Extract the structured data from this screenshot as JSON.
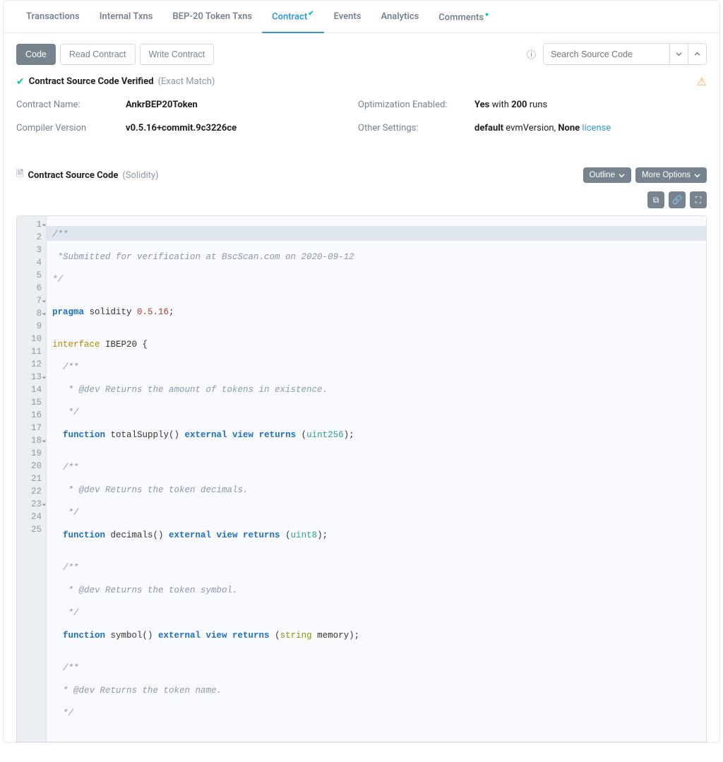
{
  "tabs": {
    "transactions": "Transactions",
    "internal": "Internal Txns",
    "bep20": "BEP-20 Token Txns",
    "contract": "Contract",
    "events": "Events",
    "analytics": "Analytics",
    "comments": "Comments"
  },
  "toolbar": {
    "code": "Code",
    "read": "Read Contract",
    "write": "Write Contract"
  },
  "search": {
    "placeholder": "Search Source Code"
  },
  "verified": {
    "title": "Contract Source Code Verified",
    "match": "(Exact Match)"
  },
  "info": {
    "name_lbl": "Contract Name:",
    "name_val": "AnkrBEP20Token",
    "compiler_lbl": "Compiler Version",
    "compiler_val": "v0.5.16+commit.9c3226ce",
    "opt_lbl": "Optimization Enabled:",
    "opt_yes": "Yes",
    "opt_with": " with ",
    "opt_runs": "200",
    "opt_runs_suf": " runs",
    "other_lbl": "Other Settings:",
    "other_default": "default",
    "other_evm": " evmVersion, ",
    "other_none": "None",
    "other_license": "license"
  },
  "source": {
    "heading": "Contract Source Code",
    "lang": "(Solidity)",
    "outline": "Outline",
    "more": "More Options"
  },
  "code": {
    "l1": "/**",
    "l2": " *Submitted for verification at BscScan.com on 2020-09-12",
    "l3": "*/",
    "l4": "",
    "l5a": "pragma",
    "l5b": " solidity ",
    "l5c": "0.5.16",
    "l5d": ";",
    "l6": "",
    "l7a": "interface",
    "l7b": " IBEP20 {",
    "l8": "  /**",
    "l9": "   * @dev Returns the amount of tokens in existence.",
    "l10": "   */",
    "l11a": "  function",
    "l11b": " totalSupply() ",
    "l11c": "external view returns",
    "l11d": " (",
    "l11e": "uint256",
    "l11f": ");",
    "l12": "",
    "l13": "  /**",
    "l14": "   * @dev Returns the token decimals.",
    "l15": "   */",
    "l16a": "  function",
    "l16b": " decimals() ",
    "l16c": "external view returns",
    "l16d": " (",
    "l16e": "uint8",
    "l16f": ");",
    "l17": "",
    "l18": "  /**",
    "l19": "   * @dev Returns the token symbol.",
    "l20": "   */",
    "l21a": "  function",
    "l21b": " symbol() ",
    "l21c": "external view returns",
    "l21d": " (",
    "l21e": "string",
    "l21f": " memory);",
    "l22": "",
    "l23": "  /**",
    "l24": "  * @dev Returns the token name.",
    "l25": "  */"
  }
}
